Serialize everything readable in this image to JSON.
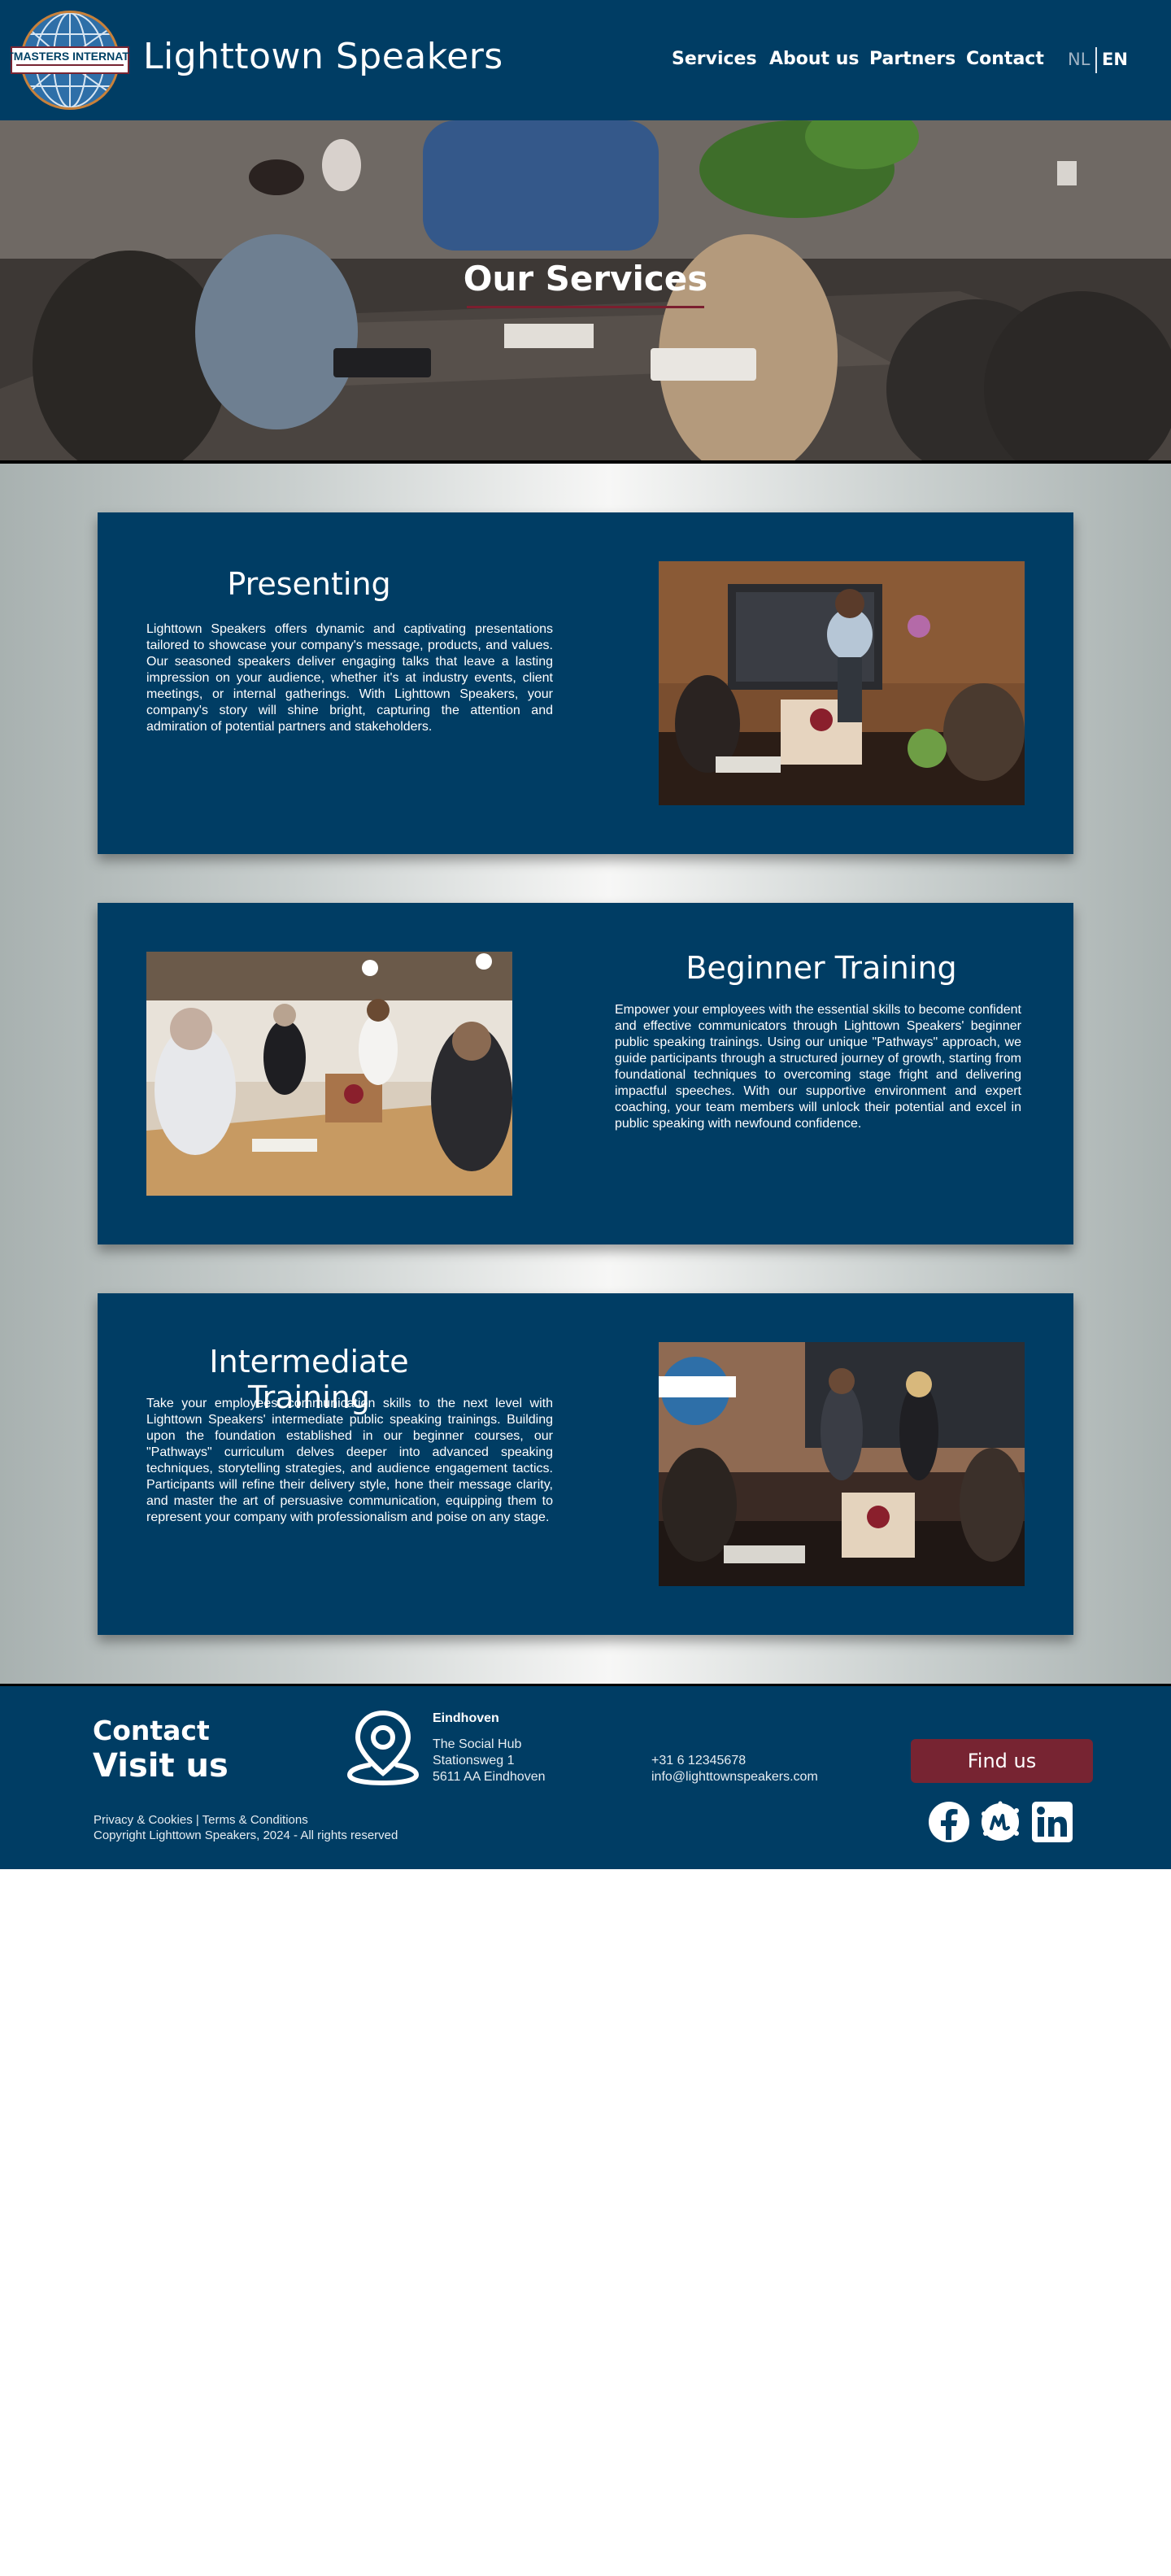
{
  "header": {
    "logo_text": "TOASTMASTERS INTERNATIONAL",
    "title": "Lighttown Speakers",
    "nav": {
      "services": "Services",
      "about": "About us",
      "partners": "Partners",
      "contact": "Contact"
    },
    "lang": {
      "nl": "NL",
      "en": "EN",
      "active": "EN"
    }
  },
  "hero": {
    "title": "Our Services"
  },
  "services": [
    {
      "title": "Presenting",
      "text": "Lighttown Speakers offers dynamic and captivating presentations tailored to showcase your company's message, products, and values. Our seasoned speakers deliver engaging talks that leave a lasting impression on your audience, whether it's at industry events, client meetings, or internal gatherings. With Lighttown Speakers, your company's story will shine bright, capturing the attention and admiration of potential partners and stakeholders."
    },
    {
      "title": "Beginner Training",
      "text": "Empower your employees with the essential skills to become confident and effective communicators through Lighttown Speakers' beginner public speaking trainings. Using our unique \"Pathways\" approach, we guide participants through a structured journey of growth, starting from foundational techniques to overcoming stage fright and delivering impactful speeches. With our supportive environment and expert coaching, your team members will unlock their potential and excel in public speaking with newfound confidence."
    },
    {
      "title": "Intermediate Training",
      "text": "Take your employees' communication skills to the next level with Lighttown Speakers' intermediate public speaking trainings. Building upon the foundation established in our beginner courses, our \"Pathways\" curriculum delves deeper into advanced speaking techniques, storytelling strategies, and audience engagement tactics. Participants will refine their delivery style, hone their message clarity, and master the art of persuasive communication, equipping them to represent your company with professionalism and poise on any stage."
    }
  ],
  "footer": {
    "contact": "Contact",
    "visit": "Visit us",
    "legal": "Privacy & Cookies | Terms & Conditions",
    "copyright": "Copyright Lighttown Speakers, 2024 - All rights reserved",
    "city": "Eindhoven",
    "address_line1": "The Social Hub",
    "address_line2": "Stationsweg 1",
    "address_line3": "5611 AA Eindhoven",
    "phone": "+31 6 12345678",
    "email": "info@lighttownspeakers.com",
    "button": "Find us",
    "social": [
      "facebook-icon",
      "meetup-icon",
      "linkedin-icon"
    ]
  },
  "colors": {
    "navy": "#003d64",
    "maroon": "#772432",
    "accent_red": "#7b1f2f"
  }
}
